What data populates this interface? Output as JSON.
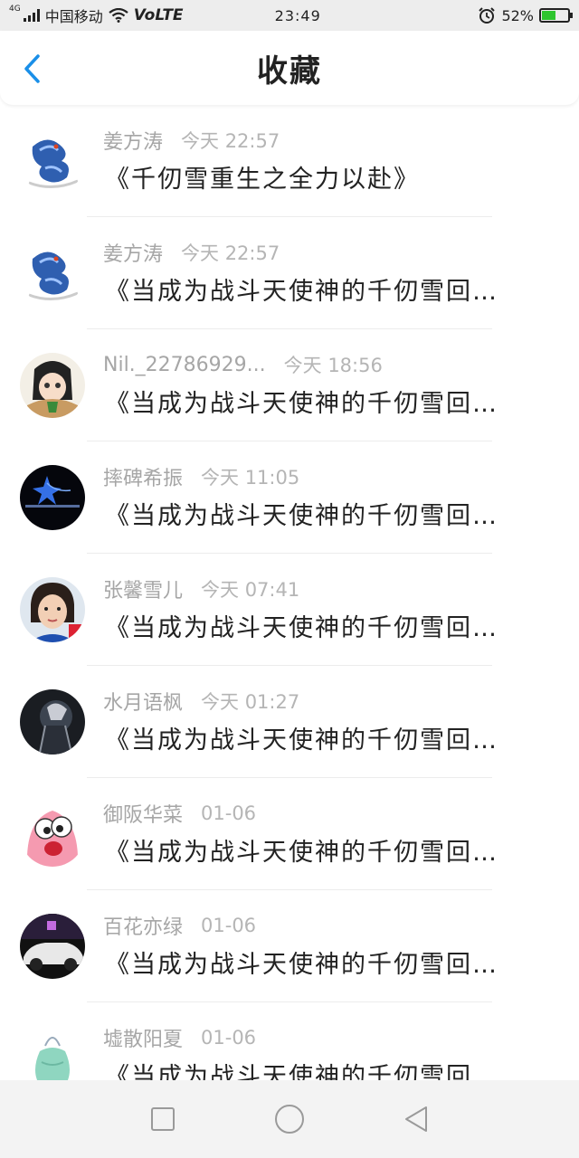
{
  "status_bar": {
    "carrier": "中国移动",
    "network": "4G",
    "volte": "VoLTE",
    "time": "23:49",
    "battery": "52%",
    "battery_level": 0.52
  },
  "header": {
    "title": "收藏"
  },
  "items": [
    {
      "sender": "姜方涛",
      "time": "今天 22:57",
      "title": "《千仞雪重生之全力以赴》",
      "avatar": "dragon"
    },
    {
      "sender": "姜方涛",
      "time": "今天 22:57",
      "title": "《当成为战斗天使神的千仞雪回…",
      "avatar": "dragon"
    },
    {
      "sender": "Nil._22786929...",
      "time": "今天 18:56",
      "title": "《当成为战斗天使神的千仞雪回…",
      "avatar": "anime-girl"
    },
    {
      "sender": "摔碑希振",
      "time": "今天 11:05",
      "title": "《当成为战斗天使神的千仞雪回…",
      "avatar": "night-star"
    },
    {
      "sender": "张馨雪儿",
      "time": "今天 07:41",
      "title": "《当成为战斗天使神的千仞雪回…",
      "avatar": "girl-photo"
    },
    {
      "sender": "水月语枫",
      "time": "今天 01:27",
      "title": "《当成为战斗天使神的千仞雪回…",
      "avatar": "dark-figure"
    },
    {
      "sender": "御阪华菜",
      "time": "01-06",
      "title": "《当成为战斗天使神的千仞雪回…",
      "avatar": "patrick"
    },
    {
      "sender": "百花亦绿",
      "time": "01-06",
      "title": "《当成为战斗天使神的千仞雪回…",
      "avatar": "car"
    },
    {
      "sender": "墟散阳夏",
      "time": "01-06",
      "title": "《当成为战斗天使神的千仞雪回",
      "avatar": "bag"
    }
  ],
  "nav_bar": {
    "recent_icon": "square-icon",
    "home_icon": "circle-icon",
    "back_icon": "triangle-icon"
  },
  "colors": {
    "accent": "#1a8fe8",
    "sender": "#a6a6a6",
    "time": "#b5b5b5"
  }
}
